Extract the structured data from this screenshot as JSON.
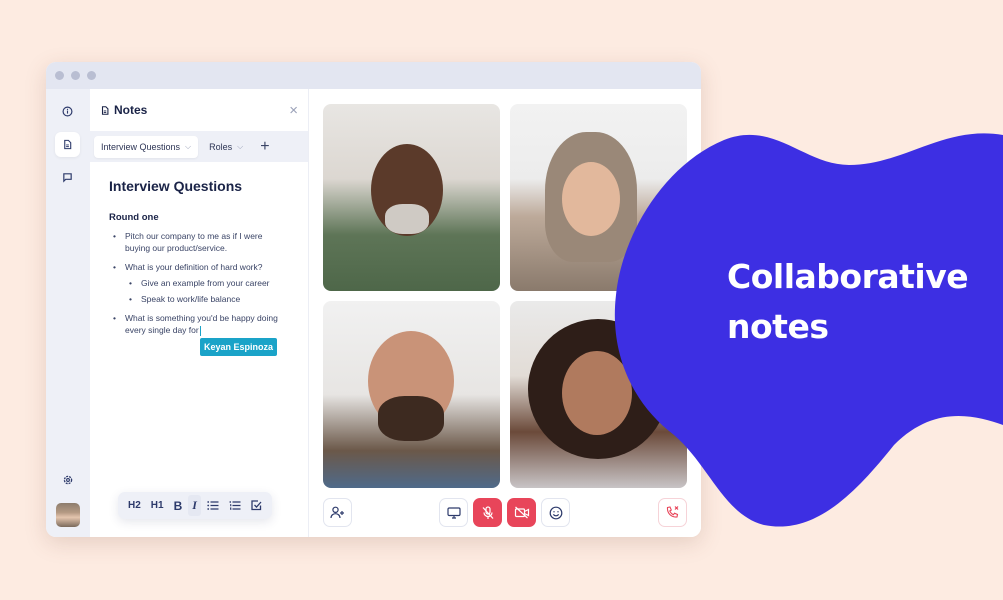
{
  "window": {
    "title_dots": 3
  },
  "rail": {
    "items": [
      {
        "name": "info",
        "icon": "info-icon"
      },
      {
        "name": "notes",
        "icon": "document-icon",
        "active": true
      },
      {
        "name": "chat",
        "icon": "chat-icon"
      }
    ],
    "settings_icon": "gear-icon",
    "avatar": "user-avatar"
  },
  "notes": {
    "title": "Notes",
    "close_label": "×",
    "tabs": [
      {
        "label": "Interview Questions",
        "active": true
      },
      {
        "label": "Roles",
        "active": false
      }
    ],
    "add_tab_label": "+",
    "doc": {
      "heading": "Interview Questions",
      "section": "Round one",
      "items": [
        {
          "text": "Pitch our company to me as if I were buying our product/service."
        },
        {
          "text": "What is your definition of hard work?",
          "sub": [
            "Give an example from your career",
            "Speak to work/life balance"
          ]
        },
        {
          "text": "What is something you'd be happy doing every single day for"
        }
      ],
      "collaborator_cursor": "Keyan Espinoza",
      "cursor_color": "#1aa3c8"
    },
    "format_toolbar": [
      "H2",
      "H1",
      "B",
      "I",
      "bullet-list",
      "numbered-list",
      "checkbox"
    ]
  },
  "video": {
    "participants": [
      "participant-1",
      "participant-2",
      "participant-3",
      "participant-4"
    ],
    "controls": {
      "add_participant": "add-participant",
      "screen_share": "screen-share",
      "mute": "microphone-muted",
      "camera": "camera-off",
      "reactions": "emoji",
      "end_call": "end-call"
    },
    "alert_color": "#e8455a"
  },
  "hero": {
    "line1": "Collaborative",
    "line2": "notes",
    "blob_color": "#3d2fe3"
  }
}
